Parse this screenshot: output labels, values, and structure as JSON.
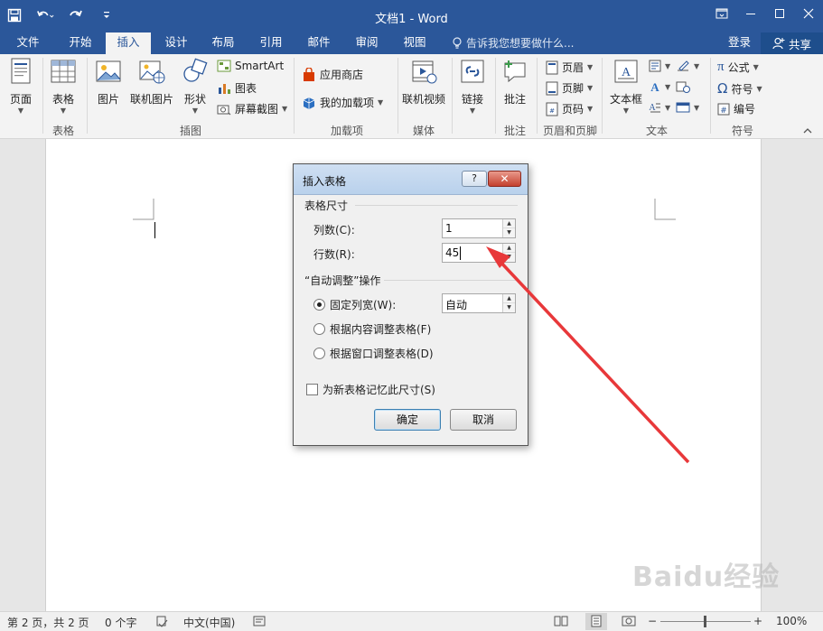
{
  "window": {
    "title": "文档1 - Word",
    "accent": "#2b579a",
    "controls": [
      "restore-ribbon-icon",
      "minimize-icon",
      "maximize-icon",
      "close-icon"
    ]
  },
  "quick_access": [
    "save-icon",
    "undo-icon",
    "redo-icon",
    "customize-icon"
  ],
  "tabs": [
    "文件",
    "开始",
    "插入",
    "设计",
    "布局",
    "引用",
    "邮件",
    "审阅",
    "视图"
  ],
  "active_tab": "插入",
  "tell_me": "告诉我您想要做什么...",
  "login": "登录",
  "share": "共享",
  "ribbon": {
    "page": "页面",
    "table": "表格",
    "picture": "图片",
    "online_picture": "联机图片",
    "shapes": "形状",
    "smartart": "SmartArt",
    "chart": "图表",
    "screenshot": "屏幕截图",
    "store": "应用商店",
    "my_addins": "我的加载项",
    "online_video": "联机视频",
    "link": "链接",
    "comment": "批注",
    "header": "页眉",
    "footer": "页脚",
    "page_number": "页码",
    "textbox": "文本框",
    "equation": "公式",
    "symbol": "符号",
    "numbering": "编号",
    "groups": {
      "tables": "表格",
      "illustrations": "插图",
      "addins": "加载项",
      "media": "媒体",
      "comments": "批注",
      "header_footer": "页眉和页脚",
      "text": "文本",
      "symbols": "符号"
    }
  },
  "dialog": {
    "title": "插入表格",
    "help": "?",
    "size_section": "表格尺寸",
    "columns_label": "列数(C):",
    "columns_value": "1",
    "rows_label": "行数(R):",
    "rows_value": "45",
    "autofit_section": "“自动调整”操作",
    "fixed_width_label": "固定列宽(W):",
    "fixed_width_value": "自动",
    "autofit_contents": "根据内容调整表格(F)",
    "autofit_window": "根据窗口调整表格(D)",
    "selected_option": "fixed_width",
    "remember": "为新表格记忆此尺寸(S)",
    "ok": "确定",
    "cancel": "取消"
  },
  "status": {
    "page": "第 2 页，共 2 页",
    "words": "0 个字",
    "language": "中文(中国)",
    "zoom": "100%",
    "zoom_level": 100
  },
  "annotation": {
    "arrow_color": "#e8383a"
  },
  "watermark": "Baidu经验"
}
